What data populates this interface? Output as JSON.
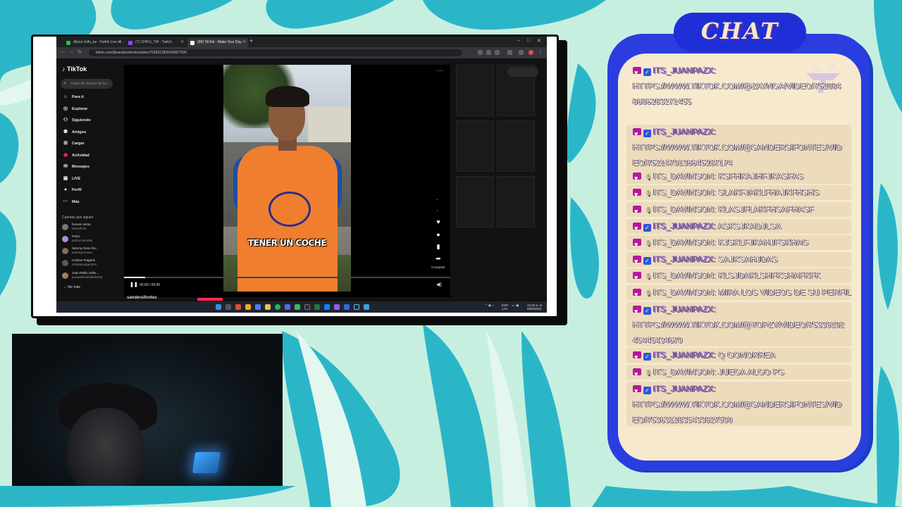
{
  "browser": {
    "tabs": [
      {
        "label": "About chifu_tw - Twitch Live st..."
      },
      {
        "label": "(7) CHIFU_TW - Twitch"
      },
      {
        "label": "(98) TikTok - Make Your Day"
      }
    ],
    "url": "tiktok.com/@sandersifontes/video/7536312835433827590"
  },
  "tiktok": {
    "logo": "TikTok",
    "search_placeholder": "Gasto de Gastos de bo...",
    "nav": [
      {
        "label": "Para ti",
        "icon": "home-icon"
      },
      {
        "label": "Explorar",
        "icon": "compass-icon"
      },
      {
        "label": "Siguiendo",
        "icon": "following-icon"
      },
      {
        "label": "Amigos",
        "icon": "friends-icon"
      },
      {
        "label": "Cargar",
        "icon": "upload-icon"
      },
      {
        "label": "Actividad",
        "icon": "activity-icon"
      },
      {
        "label": "Mensajes",
        "icon": "messages-icon"
      },
      {
        "label": "LIVE",
        "icon": "live-icon"
      },
      {
        "label": "Perfil",
        "icon": "profile-icon"
      },
      {
        "label": "Más",
        "icon": "more-icon"
      }
    ],
    "following_title": "Cuentas que sigues",
    "following": [
      {
        "name": "hoxven verse",
        "handle": "familybrok"
      },
      {
        "name": "Putzo",
        "handle": "putzocolombia"
      },
      {
        "name": "Sammy Esso Ra...",
        "handle": "sammyeusseo"
      },
      {
        "name": "Cristian Pulgarín",
        "handle": "cristianpulgarin01"
      },
      {
        "name": "Juan Pablo Uribe...",
        "handle": "juanpabloubetkeherta"
      }
    ],
    "see_more": "Ver más",
    "video_caption": "TENER UN COCHE",
    "time": "00:00 / 00:00",
    "share_label": "Compartir",
    "author": "sandersifontes"
  },
  "taskbar": {
    "lang": "ESP\nLAA",
    "clock": "12:43 a. m.\n9/08/2025"
  },
  "chat": {
    "title": "CHAT",
    "messages": [
      {
        "user": "ITS_JUANPAZX",
        "badges": [
          "heart",
          "check"
        ],
        "text": "",
        "url": "HTTPS://WWW.TIKTOK.COM/@ZAYNGA/VIDEO/7520848606283271455"
      },
      {
        "user": "ITS_JUANPAZX",
        "badges": [
          "heart",
          "check"
        ],
        "text": "",
        "url": "HTTPS://WWW.TIKTOK.COM/@SANDERSIFONTES/VIDEO/7521479136645287174"
      },
      {
        "user": "ITS_DAVINSON",
        "badges": [
          "heart",
          "mic"
        ],
        "text": "KSFHKAJHFJKASFAS"
      },
      {
        "user": "ITS_DAVINSON",
        "badges": [
          "heart",
          "mic"
        ],
        "text": "SLAKFJAKLFHAJKFHSHS"
      },
      {
        "user": "ITS_DAVINSON",
        "badges": [
          "heart",
          "mic"
        ],
        "text": "KLASJFLAKFHSAFHASF"
      },
      {
        "user": "ITS_JUANPAZX",
        "badges": [
          "heart",
          "check"
        ],
        "text": "ASKSJKADJLSA"
      },
      {
        "user": "ITS_DAVINSON",
        "badges": [
          "heart",
          "mic"
        ],
        "text": "KJSKLFJKAHJFSKHAG"
      },
      {
        "user": "ITS_JUANPAZX",
        "badges": [
          "heart",
          "check"
        ],
        "text": "SAJKSAHJDAS"
      },
      {
        "user": "ITS_DAVINSON",
        "badges": [
          "heart",
          "mic"
        ],
        "text": "KLSJDAKLSHFKSHAFKFK"
      },
      {
        "user": "ITS_DAVINSON",
        "badges": [
          "heart",
          "mic"
        ],
        "text": "MIRA LOS VIDEOS DE SU PERFIL"
      },
      {
        "user": "ITS_JUANPAZX",
        "badges": [
          "heart",
          "check"
        ],
        "text": "",
        "url": "HTTPS://WWW.TIKTOK.COM/@TOPZY/VIDEO/7533919245445434679"
      },
      {
        "user": "ITS_JUANPAZX",
        "badges": [
          "heart",
          "check"
        ],
        "text": "Q GONORREA"
      },
      {
        "user": "ITS_DAVINSON",
        "badges": [
          "heart",
          "mic"
        ],
        "text": "JUEGA ALGO PS"
      },
      {
        "user": "ITS_JUANPAZX",
        "badges": [
          "heart",
          "check"
        ],
        "text": "",
        "url": "HTTPS://WWW.TIKTOK.COM/@SANDERSIFONTES/VIDEO/7536312835433827590"
      }
    ]
  },
  "colors": {
    "chat_frame": "#2a3ee0",
    "chat_bg": "#f6e9ce",
    "juanpazx_name": "#a66cf0",
    "heart_badge": "#b5179e",
    "check_badge": "#2f56d8",
    "bg_teal": "#2bb9c4",
    "bg_mint": "#bfeedd"
  }
}
